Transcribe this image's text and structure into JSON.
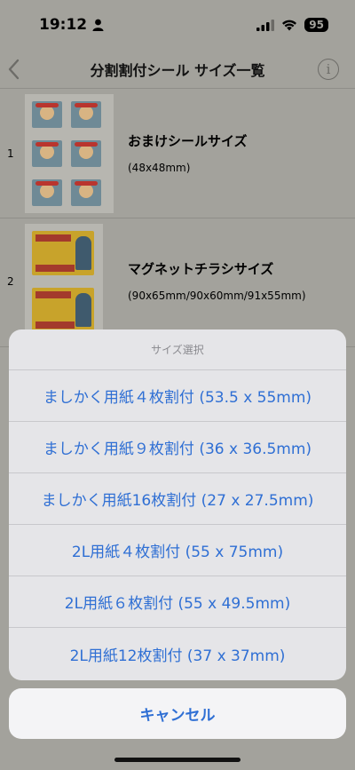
{
  "status_bar": {
    "time": "19:12",
    "battery": "95"
  },
  "nav": {
    "title": "分割割付シール サイズ一覧",
    "info_glyph": "i"
  },
  "rows": [
    {
      "index": "1",
      "title": "おまけシールサイズ",
      "subtitle": "(48x48mm)"
    },
    {
      "index": "2",
      "title": "マグネットチラシサイズ",
      "subtitle": "(90x65mm/90x60mm/91x55mm)"
    }
  ],
  "sheet": {
    "header": "サイズ選択",
    "options": [
      "ましかく用紙４枚割付 (53.5 x 55mm)",
      "ましかく用紙９枚割付 (36 x 36.5mm)",
      "ましかく用紙16枚割付 (27 x 27.5mm)",
      "2L用紙４枚割付 (55 x 75mm)",
      "2L用紙６枚割付 (55 x 49.5mm)",
      "2L用紙12枚割付 (37 x 37mm)"
    ],
    "cancel": "キャンセル"
  },
  "colors": {
    "accent": "#2f6fd4",
    "dim_background": "#a3a29c",
    "sheet": "#e5e5e8"
  },
  "icons": [
    "person-icon",
    "signal-icon",
    "wifi-icon",
    "battery-icon",
    "chevron-left-icon",
    "info-icon"
  ]
}
